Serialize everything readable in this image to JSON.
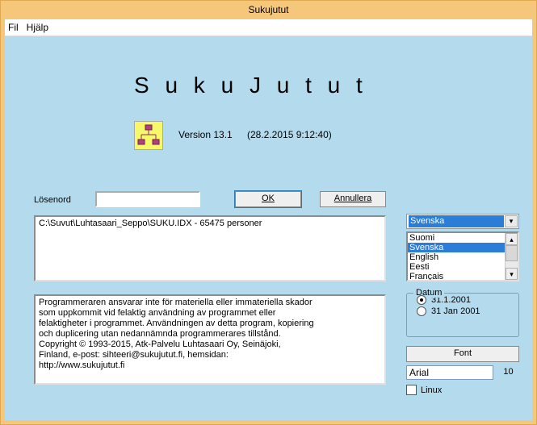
{
  "titlebar": "Sukujutut",
  "menu": {
    "file": "Fil",
    "help": "Hjälp"
  },
  "logo": "S u k u J u t u t",
  "version": "Version 13.1",
  "build": "(28.2.2015 9:12:40)",
  "password_label": "Lösenord",
  "password_value": "",
  "buttons": {
    "ok": "OK",
    "cancel": "Annullera",
    "font": "Font"
  },
  "file_path": "C:\\Suvut\\Luhtasaari_Seppo\\SUKU.IDX - 65475 personer",
  "languages": {
    "selected": "Svenska",
    "items": [
      "Suomi",
      "Svenska",
      "English",
      "Eesti",
      "Français"
    ]
  },
  "datum": {
    "legend": "Datum",
    "options": [
      "31.1.2001",
      "31 Jan 2001"
    ],
    "selected": 0
  },
  "font": {
    "name": "Arial",
    "size": "10"
  },
  "linux_label": "Linux",
  "info_lines": [
    "Programmeraren ansvarar inte för materiella eller immateriella skador",
    "som uppkommit vid felaktig användning av programmet eller",
    "felaktigheter i programmet. Användningen av detta program, kopiering",
    "och duplicering utan nedannämnda programmerares tillstånd.",
    "Copyright © 1993-2015, Atk-Palvelu Luhtasaari Oy, Seinäjoki,",
    "Finland, e-post: sihteeri@sukujutut.fi, hemsidan:",
    "http://www.sukujutut.fi"
  ]
}
